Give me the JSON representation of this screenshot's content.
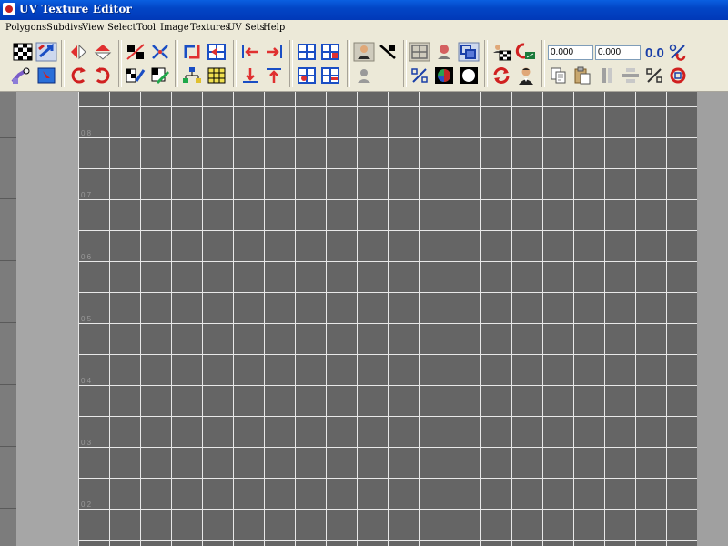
{
  "window": {
    "title": "UV Texture Editor"
  },
  "menu": {
    "items": [
      "Polygons",
      "Subdivs",
      "View",
      "Select",
      "Tool",
      "Image",
      "Textures",
      "UV Sets",
      "Help"
    ]
  },
  "toolbar": {
    "u_value": "0.000",
    "v_value": "0.000",
    "zero_label": "0.0",
    "icons": [
      "checker-icon",
      "move-icon",
      "flip-u-icon",
      "flip-v-icon",
      "rotate-ccw-icon",
      "rotate-cw-icon",
      "cut-uv-icon",
      "sew-uv-icon",
      "merge-uv-icon",
      "unfold-icon",
      "layout-icon",
      "relax-icon",
      "align-left-icon",
      "align-right-icon",
      "align-bottom-icon",
      "align-top-icon",
      "grid-snap-icon",
      "grid-add-icon",
      "grid-point-icon",
      "grid-remove-icon",
      "isolate-select-icon",
      "isolate-add-icon",
      "toggle-display-icon",
      "shaded-uv-icon",
      "pin-icon",
      "display-image-icon",
      "texture-border-icon",
      "auto-map-icon",
      "image-range-icon",
      "refresh-icon",
      "person-icon",
      "percent-icon",
      "copy-icon",
      "paste-icon",
      "split-icon",
      "level-icon",
      "percent-icon-2",
      "reset-icon"
    ]
  },
  "viewport": {
    "v_labels": [
      "0.8",
      "0.7",
      "0.6",
      "0.5",
      "0.4",
      "0.3",
      "0.2"
    ]
  }
}
